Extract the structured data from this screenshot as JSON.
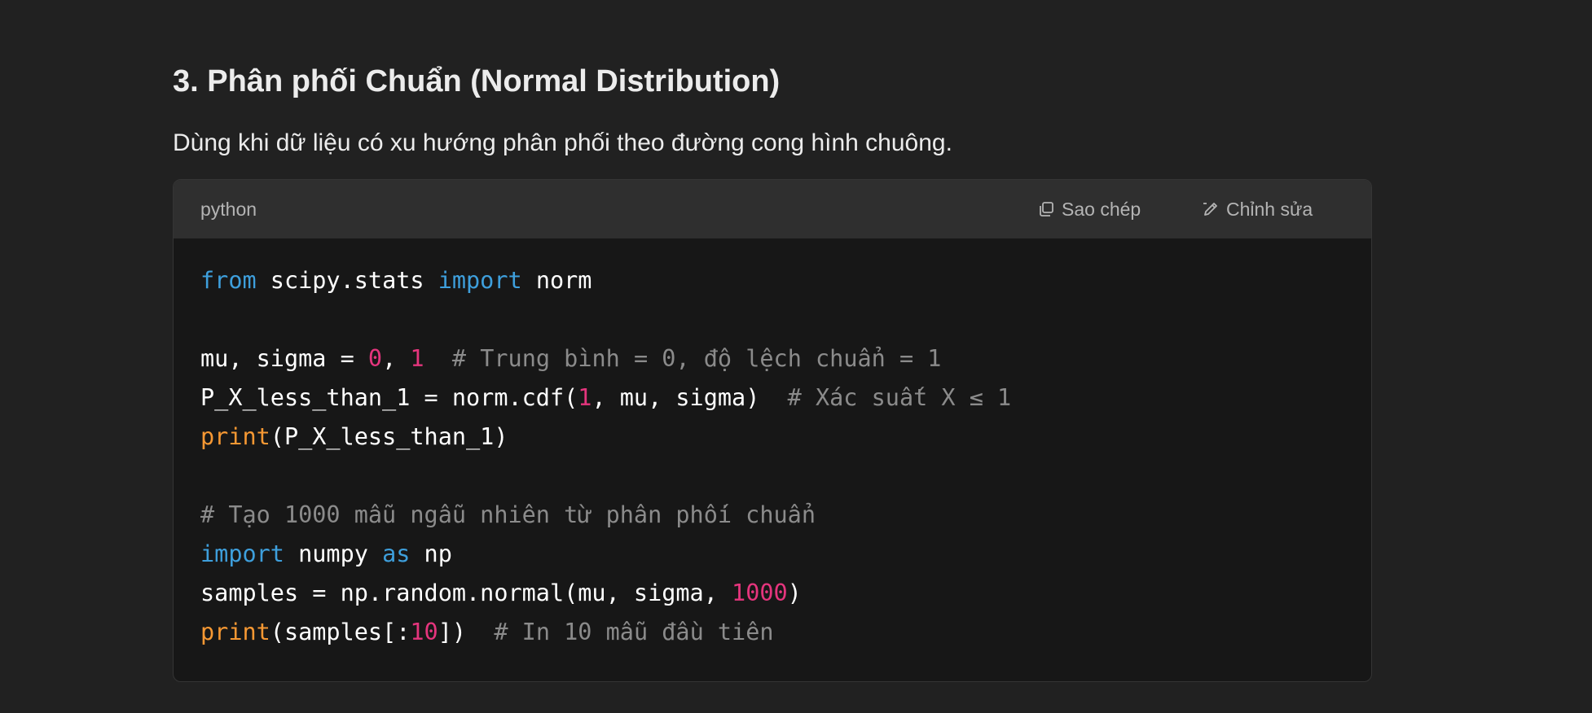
{
  "heading": "3. Phân phối Chuẩn (Normal Distribution)",
  "paragraph": "Dùng khi dữ liệu có xu hướng phân phối theo đường cong hình chuông.",
  "code_block": {
    "language": "python",
    "copy_label": "Sao chép",
    "edit_label": "Chỉnh sửa",
    "copy_icon": "copy-icon",
    "edit_icon": "pencil-icon",
    "lines": [
      [
        {
          "t": "from",
          "c": "kw"
        },
        {
          "t": " scipy.stats "
        },
        {
          "t": "import",
          "c": "kw"
        },
        {
          "t": " norm"
        }
      ],
      [],
      [
        {
          "t": "mu, sigma = "
        },
        {
          "t": "0",
          "c": "num"
        },
        {
          "t": ", "
        },
        {
          "t": "1",
          "c": "num"
        },
        {
          "t": "  "
        },
        {
          "t": "# Trung bình = 0, độ lệch chuẩn = 1",
          "c": "cm"
        }
      ],
      [
        {
          "t": "P_X_less_than_1 = norm.cdf("
        },
        {
          "t": "1",
          "c": "num"
        },
        {
          "t": ", mu, sigma)  "
        },
        {
          "t": "# Xác suất X ≤ 1",
          "c": "cm"
        }
      ],
      [
        {
          "t": "print",
          "c": "fn"
        },
        {
          "t": "(P_X_less_than_1)"
        }
      ],
      [],
      [
        {
          "t": "# Tạo 1000 mẫu ngẫu nhiên từ phân phối chuẩn",
          "c": "cm"
        }
      ],
      [
        {
          "t": "import",
          "c": "kw"
        },
        {
          "t": " numpy "
        },
        {
          "t": "as",
          "c": "kw"
        },
        {
          "t": " np"
        }
      ],
      [
        {
          "t": "samples = np.random.normal(mu, sigma, "
        },
        {
          "t": "1000",
          "c": "num"
        },
        {
          "t": ")"
        }
      ],
      [
        {
          "t": "print",
          "c": "fn"
        },
        {
          "t": "(samples[:"
        },
        {
          "t": "10",
          "c": "num"
        },
        {
          "t": "])  "
        },
        {
          "t": "# In 10 mẫu đầu tiên",
          "c": "cm"
        }
      ]
    ]
  },
  "colors": {
    "background": "#212121",
    "code_background": "#171717",
    "code_header": "#2f2f2f",
    "keyword": "#3e9fdc",
    "builtin": "#f69833",
    "number": "#e5357d",
    "comment": "#8b8b8b"
  }
}
